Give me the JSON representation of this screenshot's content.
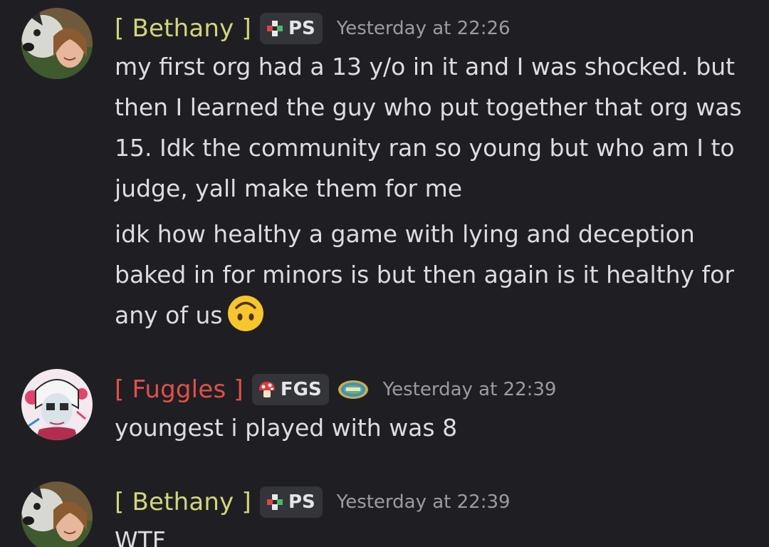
{
  "messages": [
    {
      "username": "[ Bethany ]",
      "tag": "PS",
      "timestamp": "Yesterday at 22:26",
      "lines": [
        "my first org had a 13 y/o in it and I was shocked. but then I learned the guy who put together that org was 15. Idk the community ran so young but who am I to judge, yall make them for me",
        "idk how healthy a game with lying and deception baked in for minors is but then again is it healthy for any of us"
      ],
      "emoji": "upside-down-face-emoji"
    },
    {
      "username": "[ Fuggles ]",
      "tag": "FGS",
      "timestamp": "Yesterday at 22:39",
      "lines": [
        "youngest i played with was 8"
      ]
    },
    {
      "username": "[ Bethany ]",
      "tag": "PS",
      "timestamp": "Yesterday at 22:39",
      "lines": [
        "WTF"
      ]
    }
  ],
  "colors": {
    "background": "#1f1f23",
    "bethany_name": "#d3d67b",
    "fuggles_name": "#e0504a",
    "timestamp": "#9b9ca3",
    "text": "#dcdde1"
  }
}
